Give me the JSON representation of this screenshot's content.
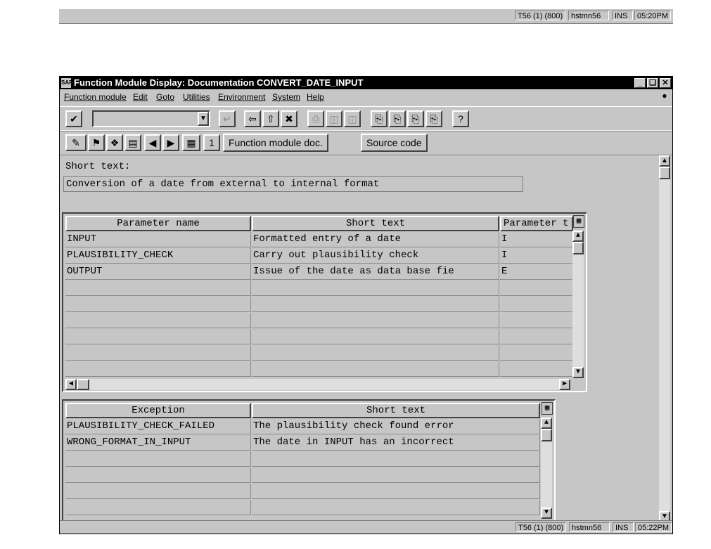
{
  "top_status": {
    "system": "T56 (1) (800)",
    "user": "hstmn56",
    "mode": "INS",
    "time": "05:20PM"
  },
  "window": {
    "title": "Function Module Display: Documentation CONVERT_DATE_INPUT",
    "controls": [
      "_",
      "❏",
      "✕"
    ]
  },
  "menu": [
    {
      "label": "Function module"
    },
    {
      "label": "Edit"
    },
    {
      "label": "Goto"
    },
    {
      "label": "Utilities"
    },
    {
      "label": "Environment"
    },
    {
      "label": "System"
    },
    {
      "label": "Help"
    }
  ],
  "toolbar1": {
    "command_value": "",
    "icons": [
      "check-icon",
      "enter-icon",
      "back-icon",
      "exit-icon",
      "cancel-icon",
      "print-icon",
      "find-icon",
      "find-next-icon",
      "first-page-icon",
      "previous-page-icon",
      "next-page-icon",
      "last-page-icon",
      "help-icon"
    ]
  },
  "toolbar2": {
    "function_module_doc": "Function module doc.",
    "source_code": "Source code"
  },
  "short_text": {
    "label": "Short text:",
    "value": "Conversion of a date from external to internal format"
  },
  "parameters": {
    "headers": [
      "Parameter name",
      "Short text",
      "Parameter t"
    ],
    "rows": [
      [
        "INPUT",
        "Formatted entry of a date",
        "I"
      ],
      [
        "PLAUSIBILITY_CHECK",
        "Carry out plausibility check",
        "I"
      ],
      [
        "OUTPUT",
        "Issue of the date as data base fie",
        "E"
      ],
      [
        "",
        "",
        ""
      ],
      [
        "",
        "",
        ""
      ],
      [
        "",
        "",
        ""
      ],
      [
        "",
        "",
        ""
      ],
      [
        "",
        "",
        ""
      ],
      [
        "",
        "",
        ""
      ]
    ]
  },
  "exceptions": {
    "headers": [
      "Exception",
      "Short text"
    ],
    "rows": [
      [
        "PLAUSIBILITY_CHECK_FAILED",
        "The plausibility check found error"
      ],
      [
        "WRONG_FORMAT_IN_INPUT",
        "The date in INPUT has an incorrect"
      ],
      [
        "",
        ""
      ],
      [
        "",
        ""
      ],
      [
        "",
        ""
      ],
      [
        "",
        ""
      ]
    ]
  },
  "bottom_status": {
    "system": "T56 (1) (800)",
    "user": "hstmn56",
    "mode": "INS",
    "time": "05:22PM"
  }
}
